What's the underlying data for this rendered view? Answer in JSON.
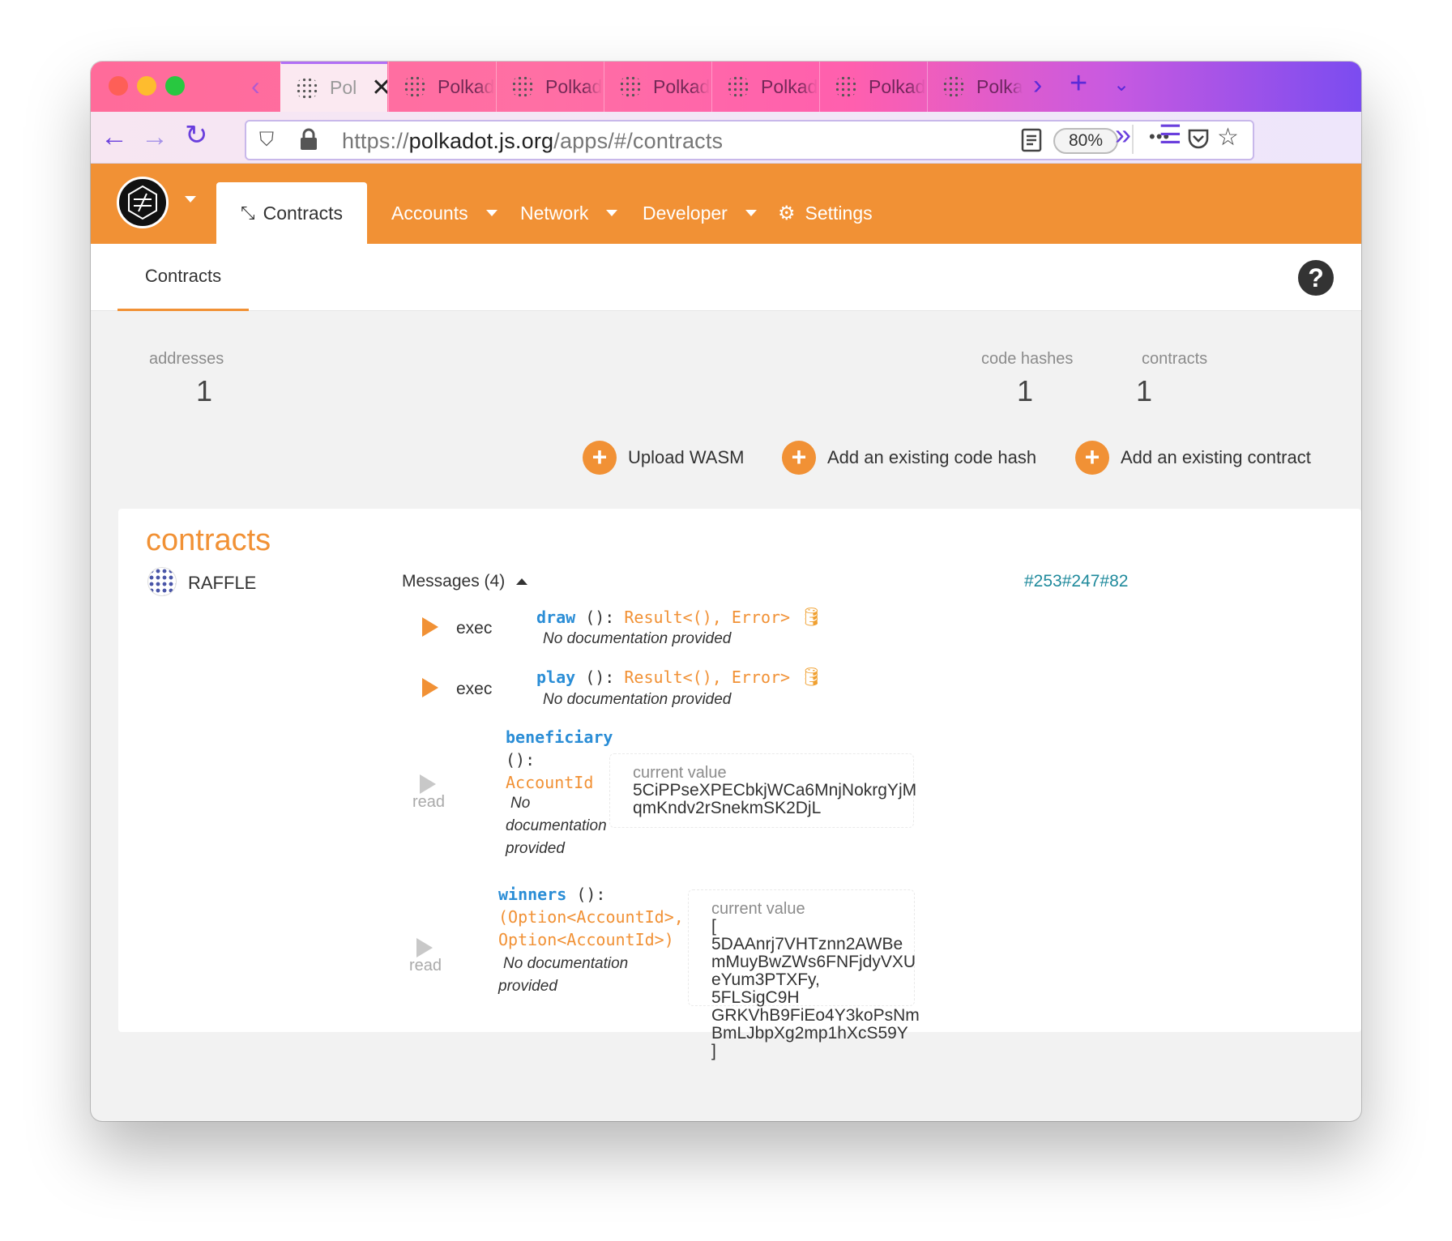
{
  "browser": {
    "tabs": [
      {
        "label": "Pol",
        "active": true
      },
      {
        "label": "Polkad"
      },
      {
        "label": "Polkad"
      },
      {
        "label": "Polkad"
      },
      {
        "label": "Polkad"
      },
      {
        "label": "Polkad"
      },
      {
        "label": "Polkad"
      }
    ],
    "url_prefix": "https://",
    "url_host": "polkadot.js.org",
    "url_path": "/apps/#/contracts",
    "zoom": "80%",
    "menu_dots": "•••"
  },
  "app": {
    "nav": {
      "contracts": "Contracts",
      "accounts": "Accounts",
      "network": "Network",
      "developer": "Developer",
      "settings": "Settings"
    },
    "subnav": {
      "contracts": "Contracts"
    },
    "help": "?",
    "stats": {
      "addresses_label": "addresses",
      "addresses_value": "1",
      "code_hashes_label": "code hashes",
      "code_hashes_value": "1",
      "contracts_label": "contracts",
      "contracts_value": "1"
    },
    "actions": {
      "upload": "Upload WASM",
      "add_code_hash": "Add an existing code hash",
      "add_contract": "Add an existing contract",
      "plus": "+"
    },
    "contracts_card": {
      "title": "contracts",
      "name": "RAFFLE",
      "messages_label": "Messages (4)",
      "hash": "#253#247#82",
      "messages": [
        {
          "action": "exec",
          "name": "draw",
          "sig": " ():",
          "type": "Result<(), Error>",
          "doc": "No documentation provided"
        },
        {
          "action": "exec",
          "name": "play",
          "sig": " ():",
          "type": "Result<(), Error>",
          "doc": "No documentation provided"
        },
        {
          "action": "read",
          "name": "beneficiary",
          "sig": "():",
          "type": "AccountId",
          "doc_lines": [
            "No",
            "documentation",
            "provided"
          ],
          "value_label": "current value",
          "value_lines": [
            "5CiPPseXPECbkjWCa6MnjNokrgYjM",
            "qmKndv2rSnekmSK2DjL"
          ]
        },
        {
          "action": "read",
          "name": "winners",
          "sig": " ():",
          "type_lines": [
            "(Option<AccountId>,",
            "Option<AccountId>)"
          ],
          "doc_lines": [
            "No documentation",
            "provided"
          ],
          "value_label": "current value",
          "value_lines": [
            "[ 5DAAnrj7VHTznn2AWBe",
            "mMuyBwZWs6FNFjdyVXU",
            "eYum3PTXFy, 5FLSigC9H",
            "GRKVhB9FiEo4Y3koPsNm",
            "BmLJbpXg2mp1hXcS59Y ]"
          ]
        }
      ]
    }
  },
  "colors": {
    "accent": "#f19135",
    "link": "#2a8dd6",
    "hash": "#1f8a9c"
  }
}
